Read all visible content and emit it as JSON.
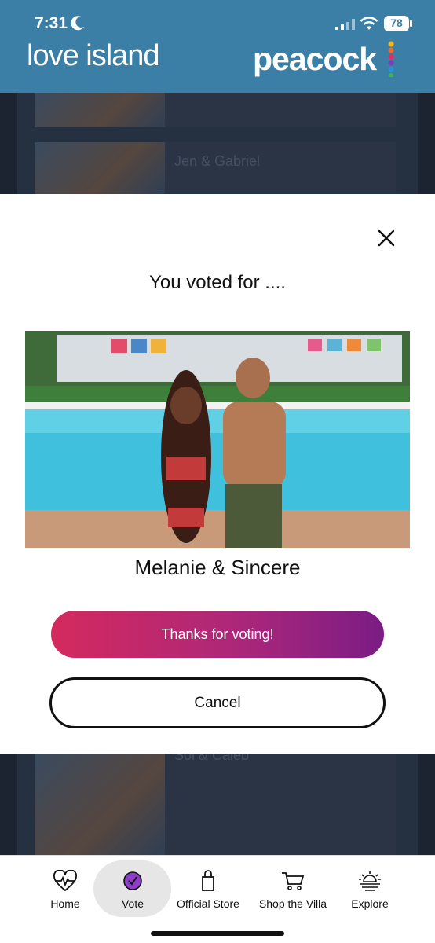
{
  "status_bar": {
    "time": "7:31",
    "battery": "78"
  },
  "header": {
    "brand_left": "love island",
    "brand_right": "peacock"
  },
  "list": {
    "cards": [
      {
        "name": ""
      },
      {
        "name": "Jen & Gabriel"
      },
      {
        "name": "Sol & Caleb"
      }
    ]
  },
  "modal": {
    "title": "You voted for ....",
    "couple_name": "Melanie & Sincere",
    "primary_button": "Thanks for voting!",
    "cancel_button": "Cancel"
  },
  "nav": {
    "items": [
      {
        "label": "Home",
        "icon": "heartbeat-icon"
      },
      {
        "label": "Vote",
        "icon": "vote-check-icon",
        "active": true
      },
      {
        "label": "Official Store",
        "icon": "shopping-bag-icon"
      },
      {
        "label": "Shop the Villa",
        "icon": "cart-icon"
      },
      {
        "label": "Explore",
        "icon": "sunset-icon"
      }
    ]
  },
  "colors": {
    "header": "#3b7fa6",
    "accent_start": "#d42a5e",
    "accent_end": "#7b1c85",
    "vote_icon": "#8e3dc8"
  }
}
